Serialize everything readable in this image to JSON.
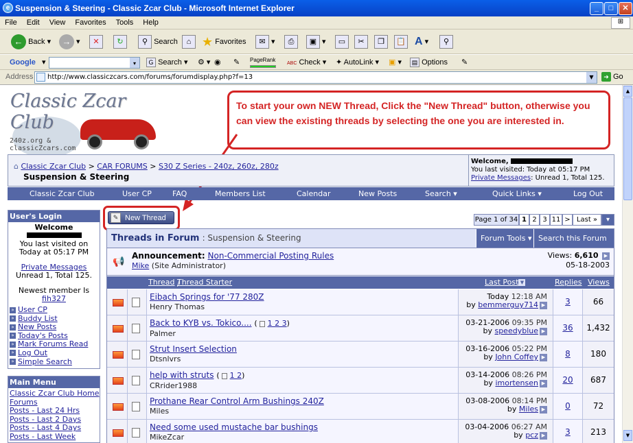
{
  "window": {
    "title": "Suspension & Steering - Classic Zcar Club - Microsoft Internet Explorer"
  },
  "menu": [
    "File",
    "Edit",
    "View",
    "Favorites",
    "Tools",
    "Help"
  ],
  "toolbar": {
    "back": "Back",
    "search": "Search",
    "favorites": "Favorites"
  },
  "googlebar": {
    "label": "Google",
    "search": "Search",
    "pagerank": "PageRank",
    "check": "Check",
    "autolink": "AutoLink",
    "options": "Options"
  },
  "address": {
    "label": "Address",
    "url": "http://www.classiczcars.com/forums/forumdisplay.php?f=13",
    "go": "Go"
  },
  "logo": {
    "title": "Classic Zcar Club",
    "sub1": "240z.org &",
    "sub2": "classicZcars.com"
  },
  "callout": "To start your own NEW Thread, Click the \"New Thread\" button, otherwise you can view the existing threads by selecting the one you are interested in.",
  "breadcrumb": {
    "home": "Classic Zcar Club",
    "sep": ">",
    "forums": "CAR FORUMS",
    "series": "S30 Z Series - 240z, 260z, 280z",
    "current": "Suspension & Steering"
  },
  "welcome": {
    "label": "Welcome,",
    "visited": "You last visited: Today at 05:17 PM",
    "pm_link": "Private Messages",
    "pm_text": ": Unread 1, Total 125."
  },
  "topnav": [
    "Classic Zcar Club",
    "User CP",
    "FAQ",
    "Members List",
    "Calendar",
    "New Posts",
    "Search ▾",
    "Quick Links ▾",
    "Log Out"
  ],
  "login": {
    "title": "User's Login",
    "welcome": "Welcome",
    "visited": "You last visited on Today at 05:17 PM",
    "pm_link": "Private Messages",
    "pm_counts": "Unread 1, Total 125.",
    "newest": "Newest member Is",
    "newest_name": "fih327",
    "links": [
      "User CP",
      "Buddy List",
      "New Posts",
      "Today's Posts",
      "Mark Forums Read",
      "Log Out",
      "Simple Search"
    ]
  },
  "mainmenu": {
    "title": "Main Menu",
    "links": [
      "Classic Zcar Club Home",
      "Forums",
      "Posts - Last 24 Hrs",
      "Posts - Last 2 Days",
      "Posts - Last 4 Days",
      "Posts - Last Week"
    ]
  },
  "newthread": "New Thread",
  "pagenav": {
    "label": "Page 1 of 34",
    "pages": [
      "1",
      "2",
      "3",
      "11",
      ">",
      "Last »",
      "▾"
    ]
  },
  "forum": {
    "heading": "Threads in Forum",
    "name": ": Suspension & Steering",
    "tools": "Forum Tools ▾",
    "search": "Search this Forum ▾"
  },
  "announcement": {
    "label": "Announcement:",
    "title": "Non-Commercial Posting Rules",
    "author": "Mike",
    "role": "(Site Administrator)",
    "views_label": "Views:",
    "views": "6,610",
    "date": "05-18-2003"
  },
  "columns": {
    "thread": "Thread",
    "slash": "/",
    "starter": "Thread Starter",
    "lastpost": "Last Post",
    "replies": "Replies",
    "views": "Views"
  },
  "threads": [
    {
      "title": "Eibach Springs for '77 280Z",
      "pages": "",
      "starter": "Henry Thomas",
      "date": "Today",
      "time": "12:18 AM",
      "by": "bemmerguy714",
      "replies": "3",
      "views": "66"
    },
    {
      "title": "Back to KYB vs. Tokico....",
      "pages": "1 2 3",
      "starter": "Palmer",
      "date": "03-21-2006",
      "time": "09:35 PM",
      "by": "speedyblue",
      "replies": "36",
      "views": "1,432"
    },
    {
      "title": "Strut Insert Selection",
      "pages": "",
      "starter": "Dtsnlvrs",
      "date": "03-16-2006",
      "time": "05:22 PM",
      "by": "John Coffey",
      "replies": "8",
      "views": "180"
    },
    {
      "title": "help with struts",
      "pages": "1 2",
      "starter": "CRrider1988",
      "date": "03-14-2006",
      "time": "08:26 PM",
      "by": "imortensen",
      "replies": "20",
      "views": "687"
    },
    {
      "title": "Prothane Rear Control Arm Bushings 240Z",
      "pages": "",
      "starter": "Miles",
      "date": "03-08-2006",
      "time": "08:14 PM",
      "by": "Miles",
      "replies": "0",
      "views": "72"
    },
    {
      "title": "Need some used mustache bar bushings",
      "pages": "",
      "starter": "MikeZcar",
      "date": "03-04-2006",
      "time": "06:27 AM",
      "by": "pcz",
      "replies": "3",
      "views": "213"
    }
  ],
  "colors": {
    "accent": "#5567a6",
    "callout": "#d42424",
    "link": "#22229c"
  }
}
